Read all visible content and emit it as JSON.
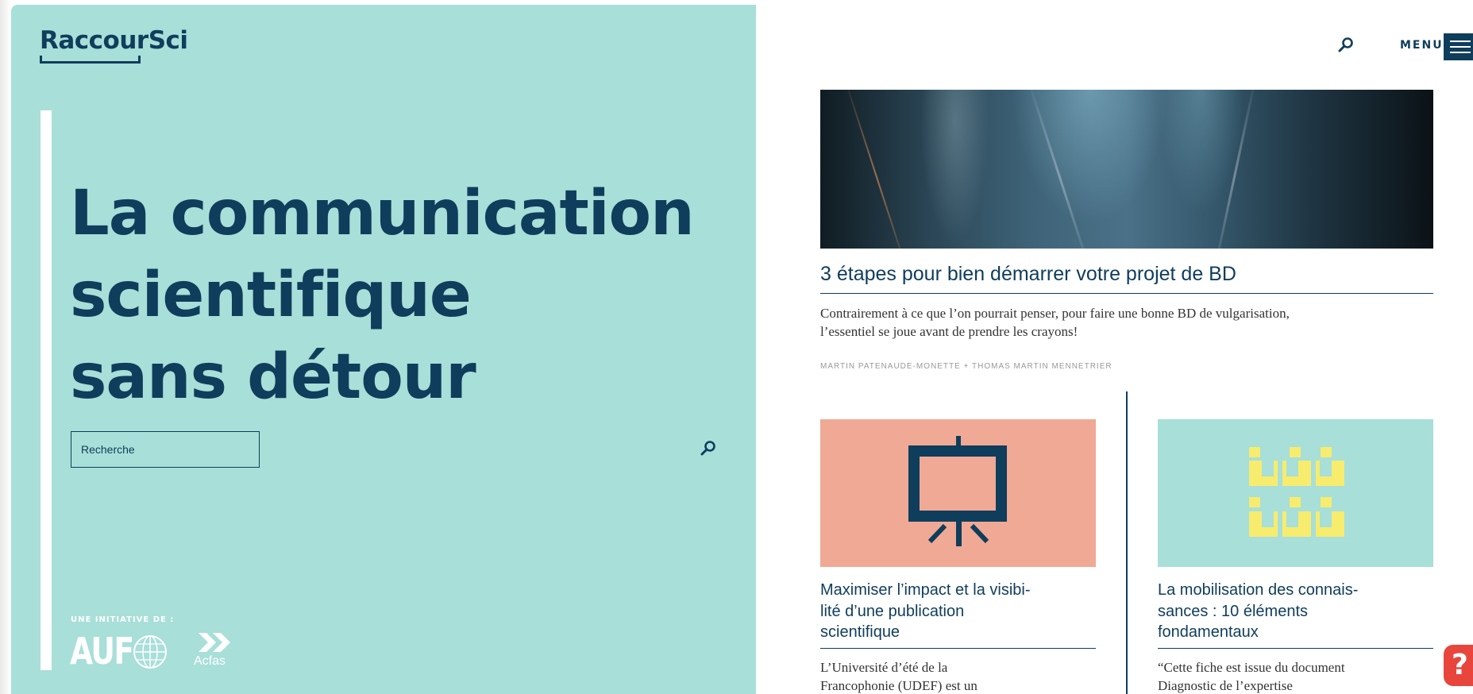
{
  "header": {
    "logo_text": "RaccourSci",
    "menu_label": "MENU",
    "search_icon": "search-icon",
    "menu_icon": "hamburger-icon"
  },
  "hero": {
    "title_lines": [
      "La communication",
      "scientifique",
      "sans détour"
    ],
    "search_placeholder": "Recherche",
    "search_icon": "search-icon",
    "initiative_label": "UNE INITIATIVE DE :",
    "partners": {
      "auf": "AUF",
      "acfas": "Acfas"
    }
  },
  "featured": {
    "title": "3 étapes pour bien démarrer votre projet de BD",
    "excerpt": "Contrairement à ce que l’on pourrait penser, pour faire une bonne BD de vulgarisation, l’essentiel se joue avant de prendre les crayons!",
    "authors": "MARTIN PATENAUDE-MONETTE + THOMAS MARTIN MENNETRIER"
  },
  "cards": [
    {
      "image_icon": "presentation-board-icon",
      "image_color": "#f0a995",
      "title_lines": [
        "Maximiser l’impact et la visibi-",
        "lité d’une publication",
        "scientifique"
      ],
      "excerpt_lines": [
        "L’Université d’été de la",
        "Francophonie (UDEF) est un"
      ]
    },
    {
      "image_icon": "building-blocks-icon",
      "image_color": "#a8dfd8",
      "title_lines": [
        "La mobilisation des connais-",
        "sances : 10 éléments",
        "fondamentaux"
      ],
      "excerpt_lines": [
        "“Cette fiche est issue du document",
        "Diagnostic de l’expertise"
      ]
    }
  ],
  "help": {
    "label": "?",
    "icon": "help-icon"
  },
  "colors": {
    "navy": "#0f3d5c",
    "mint": "#a8dfd8",
    "salmon": "#f0a995",
    "yellow": "#f7ec6e",
    "help_red": "#e8453c"
  }
}
